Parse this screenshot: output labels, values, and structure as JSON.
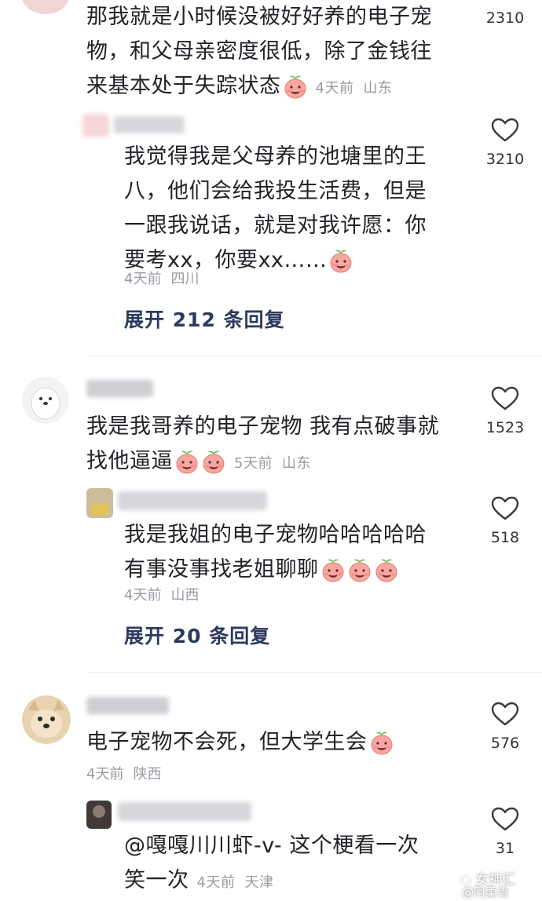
{
  "comments": [
    {
      "text": "那我就是小时候没被好好养的电子宠物，和父母亲密度很低，除了金钱往来基本处于失踪状态",
      "time": "4天前",
      "location": "山东",
      "likes": "2310",
      "emoji_count": 1
    },
    {
      "text": "我觉得我是父母养的池塘里的王八，他们会给我投生活费，但是一跟我说话，就是对我许愿：你要考xx，你要xx……",
      "time": "4天前",
      "location": "四川",
      "likes": "3210",
      "emoji_count": 1,
      "is_reply": true
    },
    {
      "text": "我是我哥养的电子宠物 我有点破事就找他逼逼",
      "time": "5天前",
      "location": "山东",
      "likes": "1523",
      "emoji_count": 2
    },
    {
      "text": "我是我姐的电子宠物哈哈哈哈哈有事没事找老姐聊聊",
      "time": "4天前",
      "location": "山西",
      "likes": "518",
      "emoji_count": 3,
      "is_reply": true
    },
    {
      "text": "电子宠物不会死，但大学生会",
      "time": "4天前",
      "location": "陕西",
      "likes": "576",
      "emoji_count": 1
    },
    {
      "text": "@嘎嘎川川虾-v- 这个梗看一次笑一次",
      "time": "4天前",
      "location": "天津",
      "likes": "31",
      "emoji_count": 0,
      "is_reply": true
    }
  ],
  "expand_links": [
    {
      "label": "展开 212 条回复"
    },
    {
      "label": "展开 20 条回复"
    }
  ],
  "lines": {
    "c0": [
      "那我就是小时候没被好好养的电子宠",
      "物，和父母亲密度很低，除了金钱往",
      "来基本处于失踪状态"
    ],
    "c1": [
      "我觉得我是父母养的池塘里的王",
      "八，他们会给我投生活费，但是",
      "一跟我说话，就是对我许愿：你",
      "要考xx，你要xx……"
    ],
    "c2": [
      "我是我哥养的电子宠物 我有点破事就",
      "找他逼逼"
    ],
    "c3": [
      "我是我姐的电子宠物哈哈哈哈哈",
      "有事没事找老姐聊聊"
    ],
    "c4": [
      "电子宠物不会死，但大学生会"
    ],
    "c5": [
      "@嘎嘎川川虾-v-  这个梗看一次",
      "笑一次"
    ]
  },
  "watermark": {
    "text": "女神汇",
    "handle": "@阿柔青"
  },
  "colors": {
    "text": "#222228",
    "meta": "#9a9aa2",
    "expand": "#2c3a5e",
    "emoji_face": "#f7a7a0",
    "emoji_leaf": "#6cbf5a"
  }
}
